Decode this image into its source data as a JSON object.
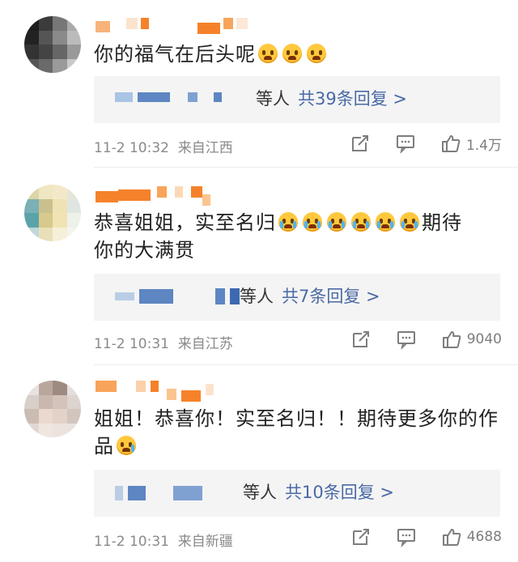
{
  "comments": [
    {
      "text": "你的福气在后头呢",
      "emoji_count": 3,
      "reply_who": "等人",
      "reply_more": "共39条回复 >",
      "time": "11-2 10:32",
      "location": "来自江西",
      "likes": "1.4万"
    },
    {
      "text_line1": "恭喜姐姐，实至名归",
      "text_tail": "期待",
      "text_line2": "你的大满贯",
      "emoji_count": 6,
      "reply_who": "等人",
      "reply_more": "共7条回复 >",
      "time": "11-2 10:31",
      "location": "来自江苏",
      "likes": "9040"
    },
    {
      "text_line1": "姐姐！恭喜你！实至名归！！期待更多你的作",
      "text_line2": "品",
      "emoji_count": 1,
      "reply_who": "等人",
      "reply_more": "共10条回复 >",
      "time": "11-2 10:31",
      "location": "来自新疆",
      "likes": "4688"
    }
  ],
  "icons": [
    "share-icon",
    "comment-icon",
    "like-icon"
  ],
  "colors": {
    "link": "#4a6aa5",
    "meta": "#8a8a8a",
    "reply_bg": "#f4f4f4",
    "name_mosaic": "#f5822a"
  }
}
